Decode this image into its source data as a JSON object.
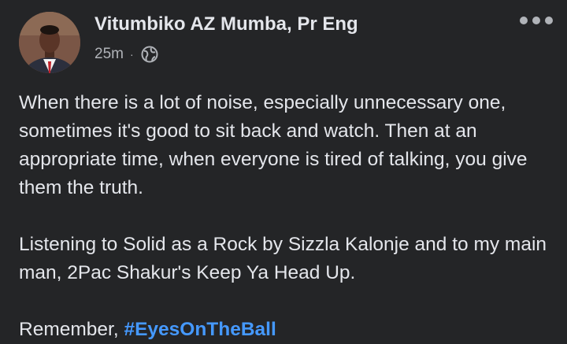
{
  "post": {
    "author": "Vitumbiko AZ Mumba, Pr Eng",
    "time": "25m",
    "separator": "·",
    "audience_icon": "globe-icon",
    "menu_icon": "more-options-icon",
    "paragraphs": [
      "When there is a lot of noise, especially unnecessary one, sometimes it's good to sit back and watch. Then at an appropriate time, when everyone is tired of talking, you give them the truth.",
      "Listening to Solid as a Rock by Sizzla Kalonje and to my main man, 2Pac Shakur's Keep Ya Head Up."
    ],
    "closing_text": "Remember, ",
    "hashtag": "#EyesOnTheBall"
  },
  "colors": {
    "background": "#242527",
    "text_primary": "#e4e6eb",
    "text_secondary": "#b0b3b8",
    "link": "#4599ff"
  }
}
